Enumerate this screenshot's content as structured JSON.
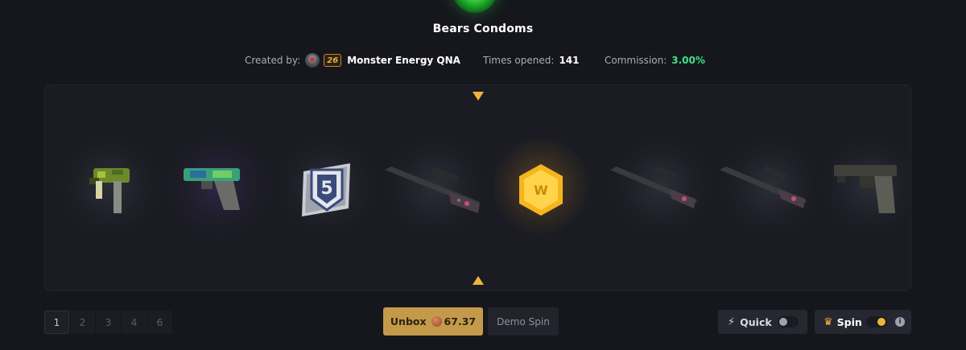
{
  "case": {
    "title": "Bears Condoms"
  },
  "meta": {
    "created_by_label": "Created by:",
    "creator_level": "26",
    "creator_name": "Monster Energy QNA",
    "times_opened_label": "Times opened:",
    "times_opened_value": "141",
    "commission_label": "Commission:",
    "commission_value": "3.00%"
  },
  "roller": {
    "items": [
      {
        "name": "mac10-icon",
        "glow": "gray"
      },
      {
        "name": "glock-icon",
        "glow": "purple"
      },
      {
        "name": "silver-rank-badge-icon",
        "glow": "gray"
      },
      {
        "name": "awp-icon",
        "glow": "gray"
      },
      {
        "name": "gold-w-coin-icon",
        "glow": "gold"
      },
      {
        "name": "awp-icon",
        "glow": "gray"
      },
      {
        "name": "awp-icon",
        "glow": "gray"
      },
      {
        "name": "cz75-icon",
        "glow": "gray"
      }
    ]
  },
  "pager": {
    "pages": [
      "1",
      "2",
      "3",
      "4",
      "6"
    ],
    "active": "1"
  },
  "actions": {
    "unbox_label": "Unbox",
    "unbox_price": "67.37",
    "demo_label": "Demo Spin",
    "quick_label": "Quick",
    "spin_label": "Spin",
    "info_label": "i"
  },
  "colors": {
    "accent_gold": "#f1b33e",
    "unbox_bg": "#c49a4a",
    "commission_green": "#3fe38a",
    "background": "#16171d"
  }
}
